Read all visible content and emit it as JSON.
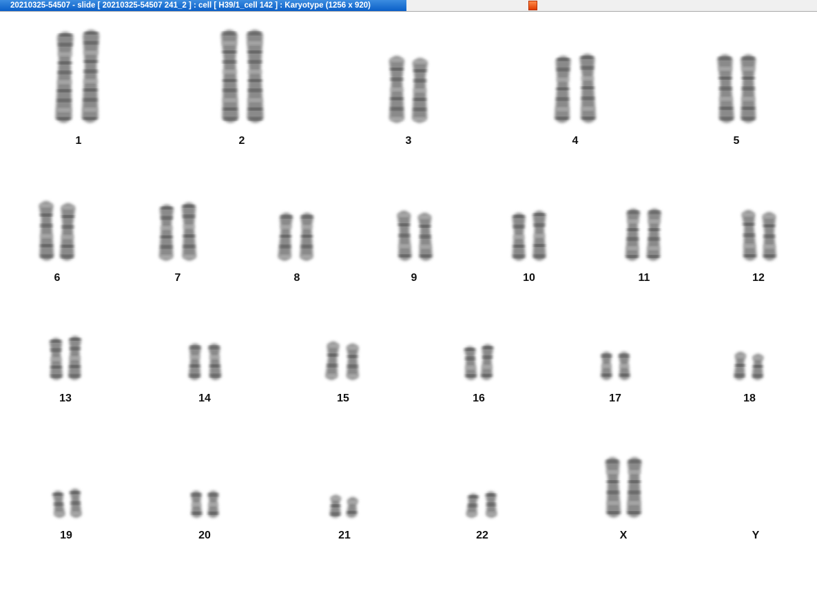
{
  "window": {
    "title": "20210325-54507 - slide [ 20210325-54507 241_2 ] : cell [ H39/1_cell 142 ] : Karyotype  (1256 x 920)"
  },
  "karyotype": {
    "chromosomes": [
      {
        "label": "1",
        "present": true
      },
      {
        "label": "2",
        "present": true
      },
      {
        "label": "3",
        "present": true
      },
      {
        "label": "4",
        "present": true
      },
      {
        "label": "5",
        "present": true
      },
      {
        "label": "6",
        "present": true
      },
      {
        "label": "7",
        "present": true
      },
      {
        "label": "8",
        "present": true
      },
      {
        "label": "9",
        "present": true
      },
      {
        "label": "10",
        "present": true
      },
      {
        "label": "11",
        "present": true
      },
      {
        "label": "12",
        "present": true
      },
      {
        "label": "13",
        "present": true
      },
      {
        "label": "14",
        "present": true
      },
      {
        "label": "15",
        "present": true
      },
      {
        "label": "16",
        "present": true
      },
      {
        "label": "17",
        "present": true
      },
      {
        "label": "18",
        "present": true
      },
      {
        "label": "19",
        "present": true
      },
      {
        "label": "20",
        "present": true
      },
      {
        "label": "21",
        "present": true
      },
      {
        "label": "22",
        "present": true
      },
      {
        "label": "X",
        "present": true
      },
      {
        "label": "Y",
        "present": false
      }
    ]
  }
}
